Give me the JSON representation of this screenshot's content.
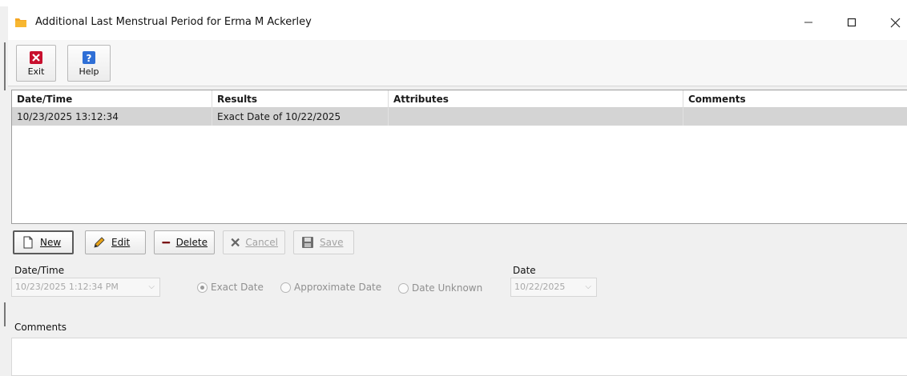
{
  "window": {
    "title": "Additional Last Menstrual Period for Erma M Ackerley",
    "minimize_glyph": "—",
    "maximize_glyph": "☐",
    "close_glyph": "✕",
    "icon": "folder-icon",
    "icon_color": "#f5a623"
  },
  "toolbar": {
    "exit_label": "Exit",
    "help_label": "Help"
  },
  "grid": {
    "columns": [
      "Date/Time",
      "Results",
      "Attributes",
      "Comments"
    ],
    "rows": [
      {
        "datetime": "10/23/2025 13:12:34",
        "results": "Exact Date of 10/22/2025",
        "attributes": "",
        "comments": ""
      }
    ],
    "selected_row_color": "#d4d4d4"
  },
  "actions": {
    "new_label": "New",
    "edit_label": "Edit",
    "delete_label": "Delete",
    "cancel_label": "Cancel",
    "save_label": "Save"
  },
  "form": {
    "datetime_label": "Date/Time",
    "datetime_value": "10/23/2025 1:12:34 PM",
    "radio_exact": "Exact Date",
    "radio_approx": "Approximate Date",
    "radio_unknown": "Date Unknown",
    "selected_radio": "Exact Date",
    "date_label": "Date",
    "date_value": "10/22/2025",
    "comments_label": "Comments",
    "comments_value": ""
  }
}
